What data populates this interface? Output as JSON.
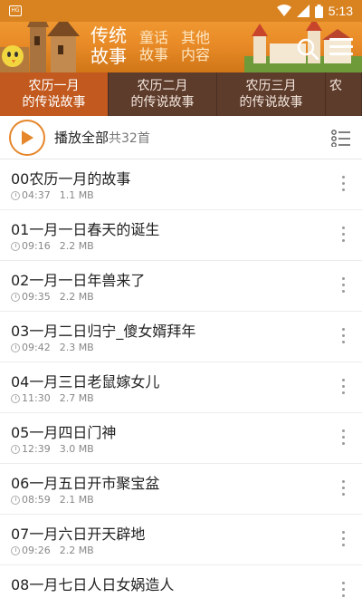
{
  "status": {
    "time": "5:13",
    "app_badge": "HG"
  },
  "header": {
    "categories": [
      {
        "line1": "传统",
        "line2": "故事"
      },
      {
        "line1": "童话",
        "line2": "故事"
      },
      {
        "line1": "其他",
        "line2": "内容"
      }
    ],
    "icons": {
      "search": "search-icon",
      "menu": "menu-icon"
    }
  },
  "tabs": [
    {
      "line1": "农历一月",
      "line2": "的传说故事"
    },
    {
      "line1": "农历二月",
      "line2": "的传说故事"
    },
    {
      "line1": "农历三月",
      "line2": "的传说故事"
    },
    {
      "line1": "农",
      "line2": ""
    }
  ],
  "playbar": {
    "label": "播放全部",
    "count": "共32首"
  },
  "tracks": [
    {
      "title": "00农历一月的故事",
      "duration": "04:37",
      "size": "1.1 MB"
    },
    {
      "title": "01一月一日春天的诞生",
      "duration": "09:16",
      "size": "2.2 MB"
    },
    {
      "title": "02一月一日年兽来了",
      "duration": "09:35",
      "size": "2.2 MB"
    },
    {
      "title": "03一月二日归宁_傻女婿拜年",
      "duration": "09:42",
      "size": "2.3 MB"
    },
    {
      "title": "04一月三日老鼠嫁女儿",
      "duration": "11:30",
      "size": "2.7 MB"
    },
    {
      "title": "05一月四日门神",
      "duration": "12:39",
      "size": "3.0 MB"
    },
    {
      "title": "06一月五日开市聚宝盆",
      "duration": "08:59",
      "size": "2.1 MB"
    },
    {
      "title": "07一月六日开天辟地",
      "duration": "09:26",
      "size": "2.2 MB"
    },
    {
      "title": "08一月七日人日女娲造人",
      "duration": "",
      "size": ""
    }
  ],
  "colors": {
    "accent": "#e6862a",
    "tab_bg": "#5d3c2c",
    "tab_active": "#c25a1f"
  }
}
